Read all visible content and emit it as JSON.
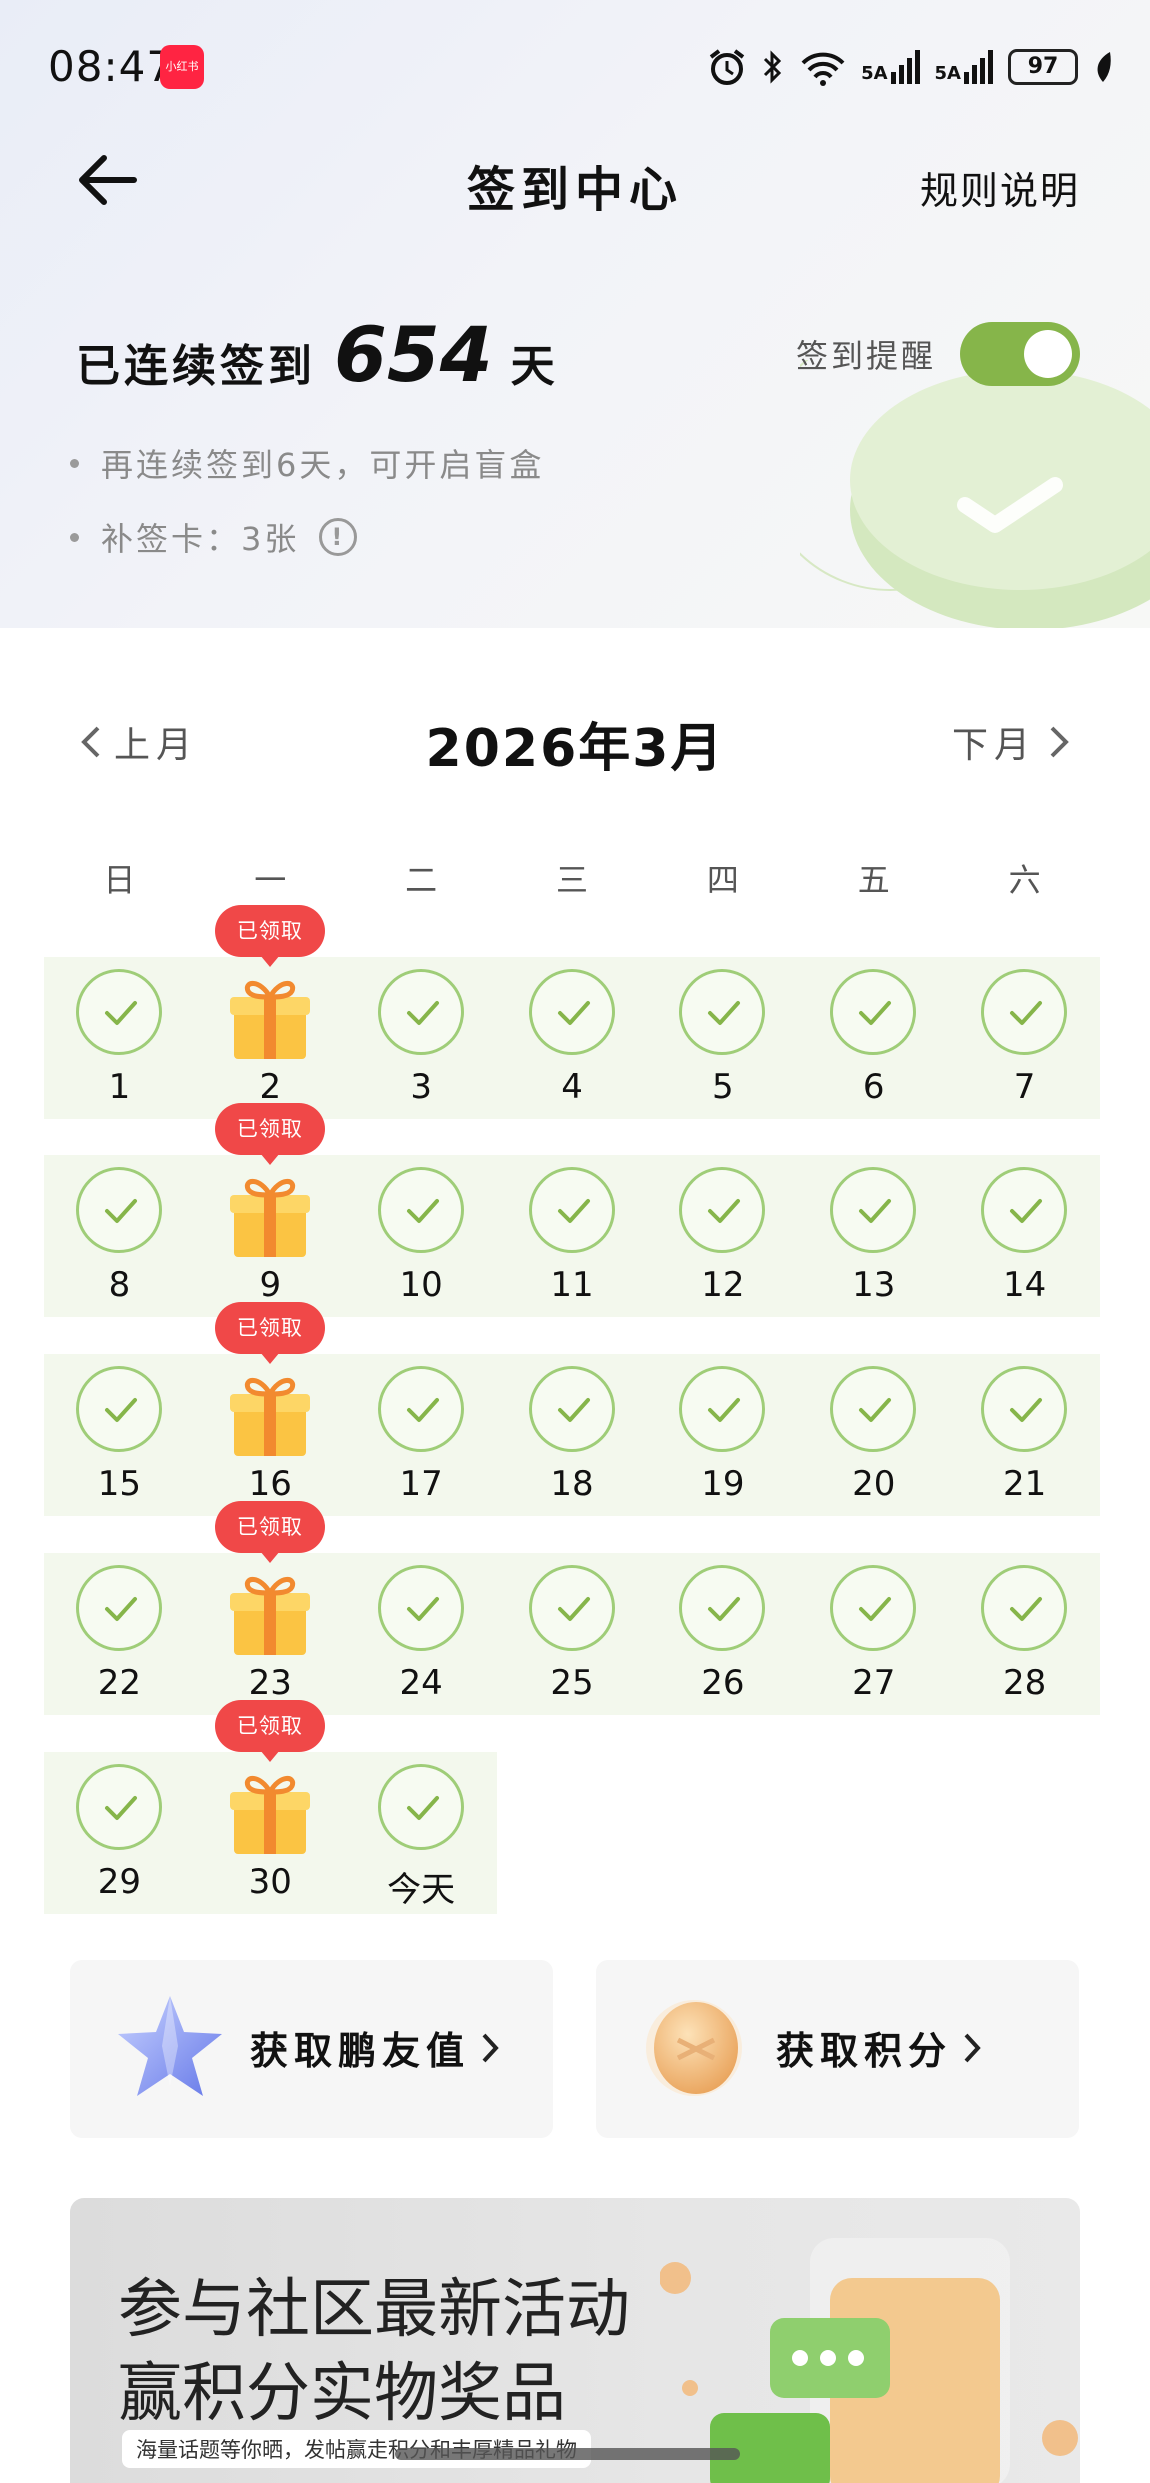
{
  "status_bar": {
    "time": "08:47",
    "app_badge": "小红书",
    "signal_label": "5A",
    "battery": "97"
  },
  "header": {
    "title": "签到中心",
    "rules_link": "规则说明"
  },
  "summary": {
    "streak_prefix": "已连续签到",
    "streak_days": "654",
    "streak_suffix": "天",
    "reminder_label": "签到提醒",
    "reminder_on": true,
    "bullet_1": "再连续签到6天，可开启盲盒",
    "bullet_2": "补签卡：3张",
    "info_icon": "!"
  },
  "calendar": {
    "prev_label": "上月",
    "next_label": "下月",
    "month_title": "2026年3月",
    "weekdays": [
      "日",
      "一",
      "二",
      "三",
      "四",
      "五",
      "六"
    ],
    "claimed_label": "已领取",
    "weeks": [
      [
        "1",
        "2",
        "3",
        "4",
        "5",
        "6",
        "7"
      ],
      [
        "8",
        "9",
        "10",
        "11",
        "12",
        "13",
        "14"
      ],
      [
        "15",
        "16",
        "17",
        "18",
        "19",
        "20",
        "21"
      ],
      [
        "22",
        "23",
        "24",
        "25",
        "26",
        "27",
        "28"
      ],
      [
        "29",
        "30",
        "今天"
      ]
    ],
    "gift_days": [
      "2",
      "9",
      "16",
      "23",
      "30"
    ]
  },
  "cards": {
    "left_label": "获取鹏友值",
    "right_label": "获取积分"
  },
  "banner": {
    "title_line1": "参与社区最新活动",
    "title_line2": "赢积分实物奖品",
    "subtitle": "海量话题等你晒，发帖赢走积分和丰厚精品礼物"
  },
  "colors": {
    "accent_green": "#86b54a",
    "check_green": "#9fcd78",
    "badge_red": "#f04848",
    "row_bg": "#f3f8ed"
  }
}
